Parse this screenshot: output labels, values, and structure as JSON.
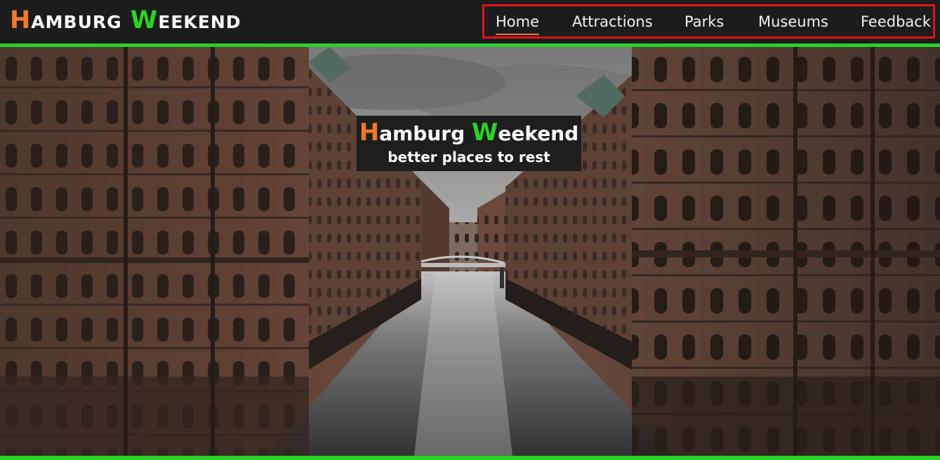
{
  "brand": {
    "first_initial": "H",
    "first_rest": "AMBURG",
    "second_initial": "W",
    "second_rest": "EEKEND",
    "first_initial_color": "#f07a2a",
    "second_initial_color": "#2bd12b"
  },
  "nav": {
    "items": [
      {
        "label": "Home",
        "active": true
      },
      {
        "label": "Attractions",
        "active": false
      },
      {
        "label": "Parks",
        "active": false
      },
      {
        "label": "Museums",
        "active": false
      },
      {
        "label": "Feedback",
        "active": false
      }
    ],
    "active_underline_color": "#f07a2a",
    "frame_color": "#e0121b"
  },
  "hero": {
    "image_description_icon": "canal-warehouses-photo",
    "frame_color": "#2bd12b",
    "caption": {
      "title_first_initial": "H",
      "title_first_rest": "amburg",
      "title_second_initial": "W",
      "title_second_rest": "eekend",
      "subtitle": "better places to rest"
    }
  }
}
